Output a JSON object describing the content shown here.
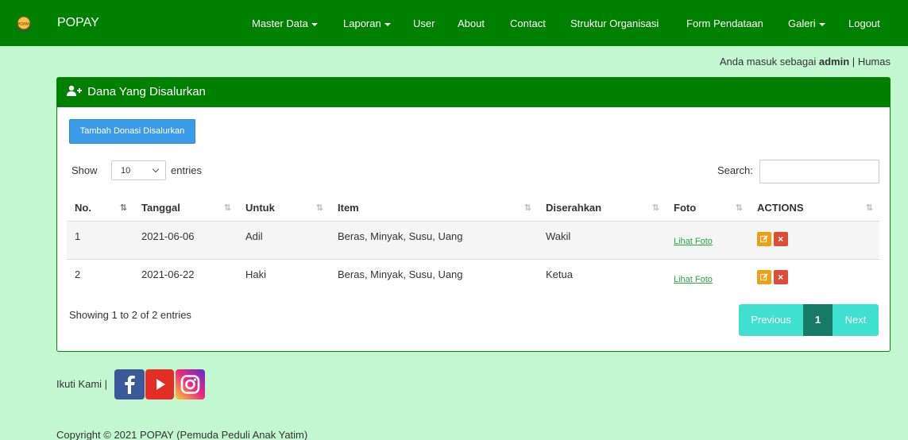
{
  "navbar": {
    "brand": "POPAY",
    "items": [
      {
        "label": "Master Data",
        "dropdown": true
      },
      {
        "label": "Laporan",
        "dropdown": true
      },
      {
        "label": "User",
        "dropdown": false
      },
      {
        "label": "About",
        "dropdown": false
      },
      {
        "label": "Contact",
        "dropdown": false
      },
      {
        "label": "Struktur Organisasi",
        "dropdown": false
      },
      {
        "label": "Form Pendataan",
        "dropdown": false
      },
      {
        "label": "Galeri",
        "dropdown": true
      },
      {
        "label": "Logout",
        "dropdown": false
      }
    ]
  },
  "user_bar": {
    "prefix": "Anda masuk sebagai",
    "username": "admin",
    "separator": "|",
    "role": "Humas"
  },
  "panel": {
    "title": "Dana Yang Disalurkan",
    "add_button": "Tambah Donasi Disalurkan",
    "show_label": "Show",
    "entries_value": "10",
    "entries_label": "entries",
    "search_label": "Search:",
    "search_value": ""
  },
  "table": {
    "headers": [
      "No.",
      "Tanggal",
      "Untuk",
      "Item",
      "Diserahkan",
      "Foto",
      "ACTIONS"
    ],
    "rows": [
      {
        "no": "1",
        "tanggal": "2021-06-06",
        "untuk": "Adil",
        "item": "Beras, Minyak, Susu, Uang",
        "diserahkan": "Wakil",
        "foto": "Lihat Foto"
      },
      {
        "no": "2",
        "tanggal": "2021-06-22",
        "untuk": "Haki",
        "item": "Beras, Minyak, Susu, Uang",
        "diserahkan": "Ketua",
        "foto": "Lihat Foto"
      }
    ]
  },
  "pagination": {
    "info": "Showing 1 to 2 of 2 entries",
    "previous": "Previous",
    "current": "1",
    "next": "Next"
  },
  "footer": {
    "follow_label": "Ikuti Kami |",
    "social": [
      "facebook-icon",
      "youtube-icon",
      "instagram-icon"
    ],
    "copyright": "Copyright © 2021 POPAY (Pemuda Peduli Anak Yatim)"
  },
  "colors": {
    "navbar": "#008000",
    "background": "#c3f7d2",
    "add_button": "#3c9be6",
    "pager": "#40e0d0",
    "pager_active": "#167a66",
    "edit": "#f39c12",
    "delete": "#dd4b39"
  }
}
